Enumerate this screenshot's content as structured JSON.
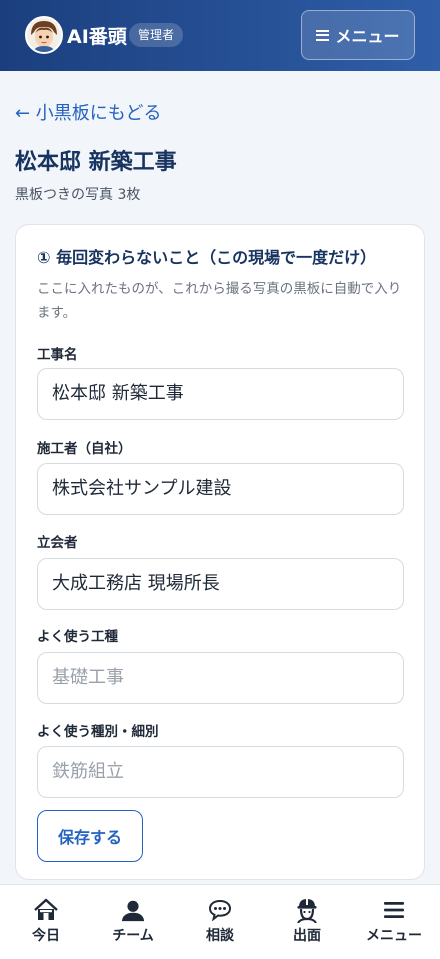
{
  "header": {
    "brand": "AI番頭",
    "role_badge": "管理者",
    "menu_label": "メニュー"
  },
  "back_link": "← 小黒板にもどる",
  "page": {
    "title": "松本邸 新築工事",
    "subtitle": "黒板つきの写真 3枚"
  },
  "card": {
    "title": "① 毎回変わらないこと（この現場で一度だけ）",
    "description": "ここに入れたものが、これから撮る写真の黒板に自動で入ります。",
    "fields": [
      {
        "label": "工事名",
        "value": "松本邸 新築工事",
        "placeholder": ""
      },
      {
        "label": "施工者（自社）",
        "value": "株式会社サンプル建設",
        "placeholder": ""
      },
      {
        "label": "立会者",
        "value": "大成工務店 現場所長",
        "placeholder": ""
      },
      {
        "label": "よく使う工種",
        "value": "",
        "placeholder": "基礎工事"
      },
      {
        "label": "よく使う種別・細別",
        "value": "",
        "placeholder": "鉄筋組立"
      }
    ],
    "save_label": "保存する"
  },
  "bottom_nav": [
    {
      "label": "今日",
      "icon": "home-icon"
    },
    {
      "label": "チーム",
      "icon": "people-icon"
    },
    {
      "label": "相談",
      "icon": "chat-icon"
    },
    {
      "label": "出面",
      "icon": "worker-icon"
    },
    {
      "label": "メニュー",
      "icon": "menu-icon"
    }
  ],
  "colors": {
    "header_start": "#1b3f7e",
    "header_end": "#2f5ea8",
    "accent": "#2563c0",
    "title": "#17335f"
  }
}
